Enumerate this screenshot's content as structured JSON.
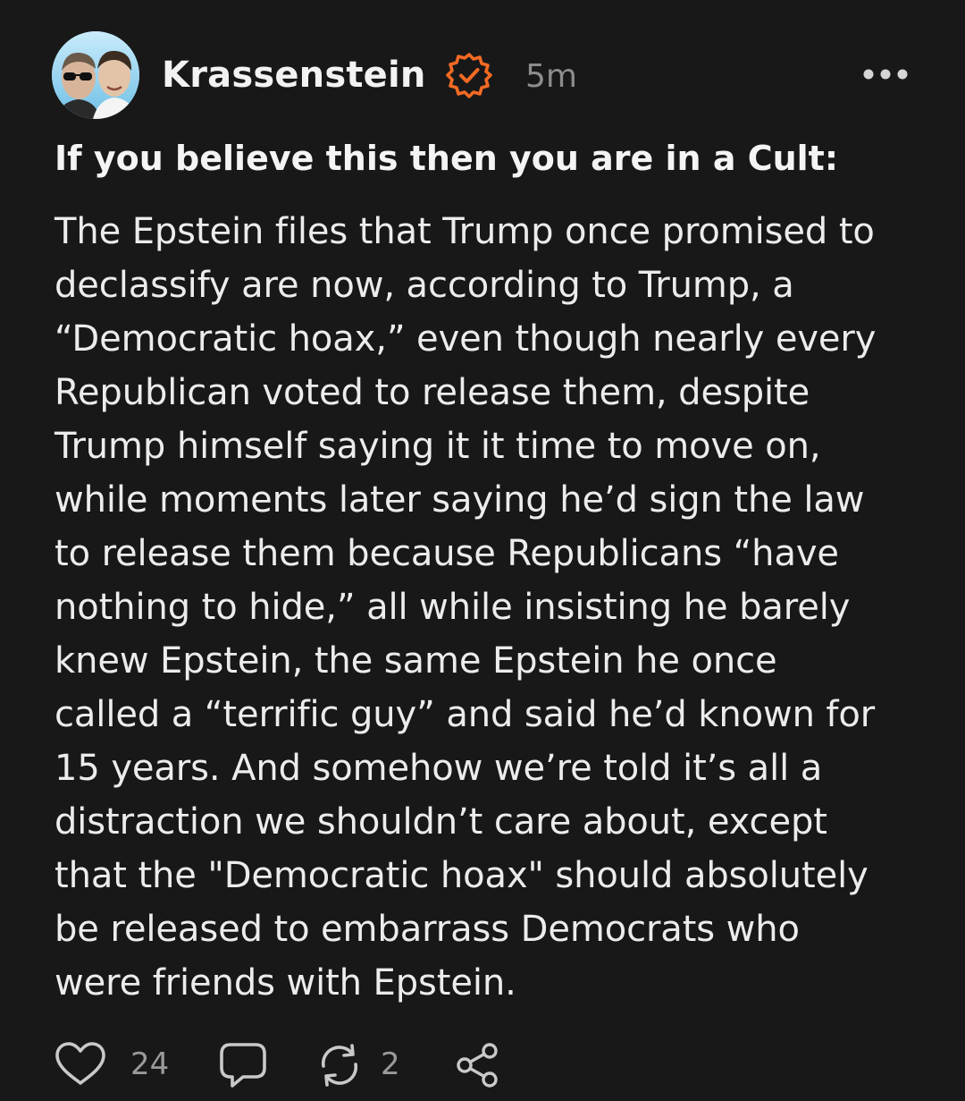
{
  "post": {
    "author": "Krassenstein",
    "time": "5m",
    "headline": "If you believe this then you are in a Cult:",
    "body": "The Epstein files that Trump once promised to\ndeclassify are now, according to Trump, a\n“Democratic hoax,” even though nearly every\nRepublican voted to release them, despite\nTrump himself saying it it time to move on,\nwhile moments later saying he’d sign the law\nto release them because Republicans “have\nnothing to hide,” all while insisting he barely\nknew Epstein, the same Epstein he once\ncalled a “terrific guy” and said he’d known for\n15 years. And somehow we’re told it’s all a\ndistraction we shouldn’t care about, except\nthat the \"Democratic hoax\" should absolutely\nbe released to embarrass Democrats who\nwere friends with Epstein.",
    "likes": "24",
    "reposts": "2"
  },
  "icons": {
    "verified": "verified-badge-icon",
    "more": "more-horizontal-icon",
    "like": "heart-icon",
    "reply": "comment-bubble-icon",
    "repost": "repost-arrows-icon",
    "share": "share-icon"
  },
  "colors": {
    "background": "#181818",
    "verified_badge": "#f36a24",
    "text": "#ececec",
    "muted": "#8d8d8d"
  }
}
